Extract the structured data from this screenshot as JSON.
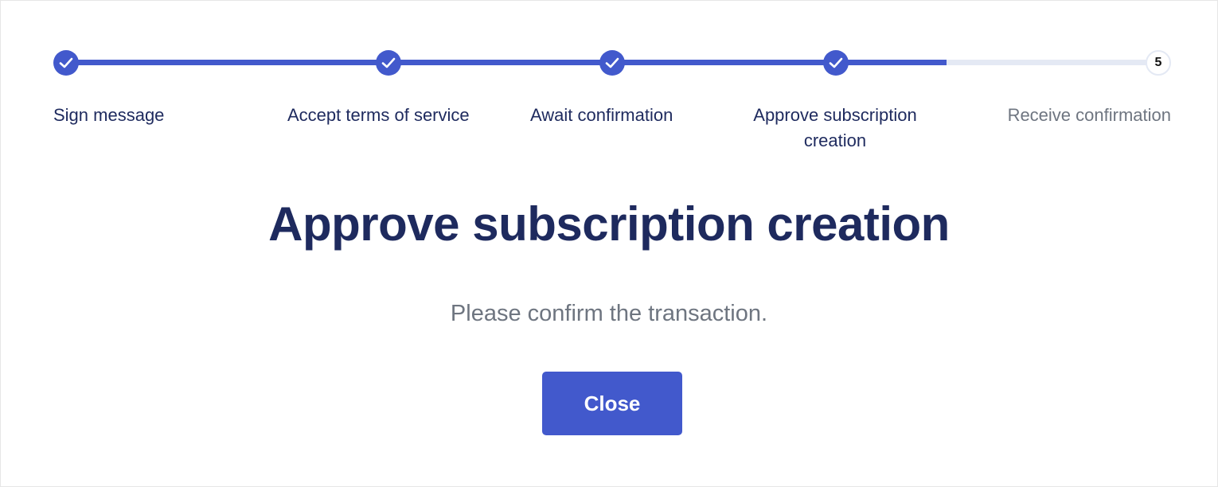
{
  "stepper": {
    "progress_fraction": 0.8,
    "steps": [
      {
        "label": "Sign message",
        "status": "done",
        "icon": "check-icon"
      },
      {
        "label": "Accept terms of service",
        "status": "done",
        "icon": "check-icon"
      },
      {
        "label": "Await confirmation",
        "status": "done",
        "icon": "check-icon"
      },
      {
        "label": "Approve subscription creation",
        "status": "done",
        "icon": "check-icon"
      },
      {
        "label": "Receive confirmation",
        "status": "pending",
        "number": "5"
      }
    ]
  },
  "main": {
    "title": "Approve subscription creation",
    "message": "Please confirm the transaction.",
    "close_label": "Close"
  },
  "colors": {
    "accent": "#4259cc",
    "heading": "#1e2a5e",
    "muted": "#6e7580",
    "track": "#e4e9f4"
  }
}
